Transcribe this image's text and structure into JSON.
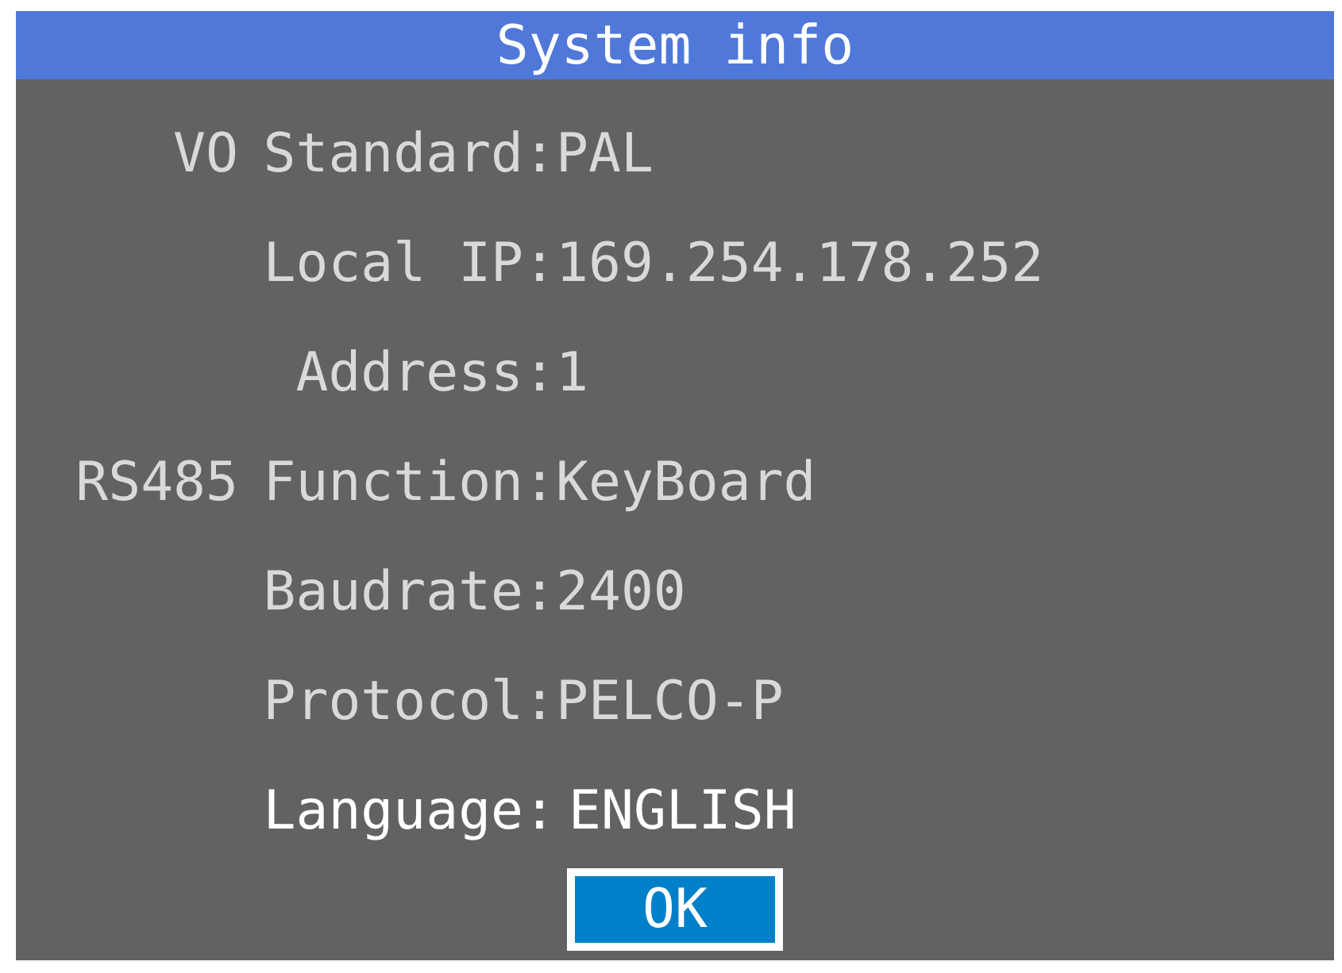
{
  "window": {
    "title": "System info"
  },
  "rows": [
    {
      "group": "VO",
      "label": "Standard:",
      "value": "PAL",
      "selected": false
    },
    {
      "label": "Local IP:",
      "value": "169.254.178.252",
      "selected": false
    },
    {
      "label": "Address:",
      "value": "1",
      "selected": false
    },
    {
      "group": "RS485",
      "label": "Function:",
      "value": "KeyBoard",
      "selected": false
    },
    {
      "label": "Baudrate:",
      "value": "2400",
      "selected": false
    },
    {
      "label": "Protocol:",
      "value": "PELCO-P",
      "selected": false
    },
    {
      "label": "Language:",
      "value": "ENGLISH",
      "selected": true
    }
  ],
  "buttons": [
    {
      "label": "OK",
      "selected": true
    }
  ]
}
